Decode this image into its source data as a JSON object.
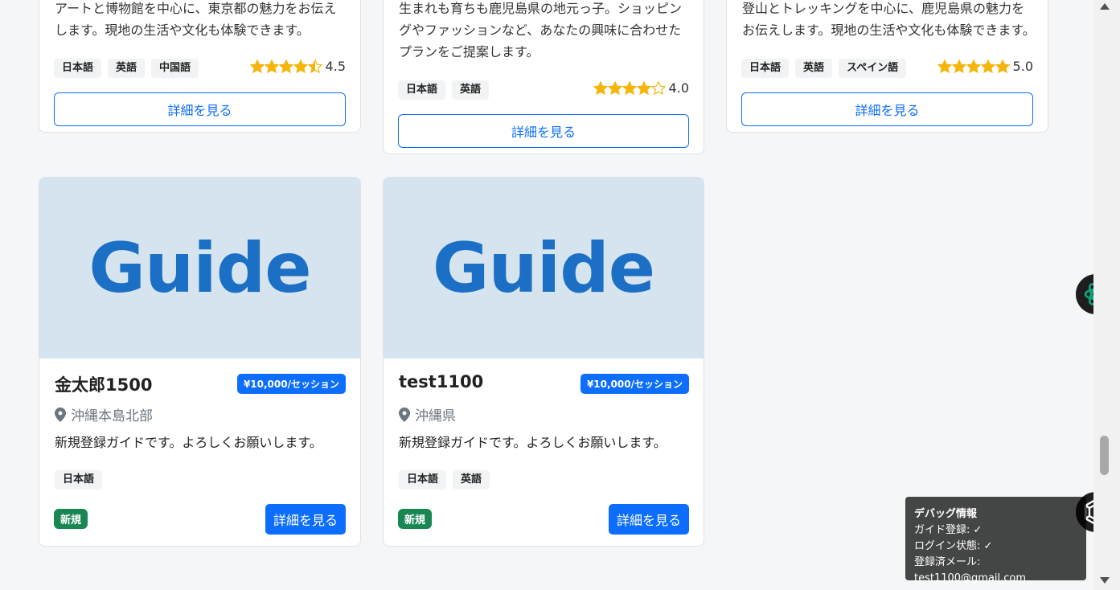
{
  "top_cards": [
    {
      "description": "アートと博物館を中心に、東京都の魅力をお伝えします。現地の生活や文化も体験できます。",
      "languages": [
        "日本語",
        "英語",
        "中国語"
      ],
      "rating": "4.5",
      "rating_value": 4.5,
      "button": "詳細を見る"
    },
    {
      "description": "生まれも育ちも鹿児島県の地元っ子。ショッピングやファッションなど、あなたの興味に合わせたプランをご提案します。",
      "languages": [
        "日本語",
        "英語"
      ],
      "rating": "4.0",
      "rating_value": 4.0,
      "button": "詳細を見る"
    },
    {
      "description": "登山とトレッキングを中心に、鹿児島県の魅力をお伝えします。現地の生活や文化も体験できます。",
      "languages": [
        "日本語",
        "英語",
        "スペイン語"
      ],
      "rating": "5.0",
      "rating_value": 5.0,
      "button": "詳細を見る"
    }
  ],
  "guide_cards": [
    {
      "image_text": "Guide",
      "name": "金太郎1500",
      "price": "¥10,000/セッション",
      "location": "沖縄本島北部",
      "description": "新規登録ガイドです。よろしくお願いします。",
      "languages": [
        "日本語"
      ],
      "badge": "新規",
      "button": "詳細を見る"
    },
    {
      "image_text": "Guide",
      "name": "test1100",
      "price": "¥10,000/セッション",
      "location": "沖縄県",
      "description": "新規登録ガイドです。よろしくお願いします。",
      "languages": [
        "日本語",
        "英語"
      ],
      "badge": "新規",
      "button": "詳細を見る"
    }
  ],
  "debug": {
    "title": "デバッグ情報",
    "line1": "ガイド登録: ✓",
    "line2": "ログイン状態: ✓",
    "line3": "登録済メール: test1100@gmail.com"
  },
  "colors": {
    "primary": "#0d6efd",
    "success": "#198754",
    "star": "#f5b50a",
    "guide_bg": "#d6e4ef",
    "guide_text": "#1b6fc4"
  },
  "icons": [
    "star-icon",
    "map-pin-icon",
    "assistant-icon",
    "chatgpt-icon",
    "scroll-up-icon",
    "scroll-down-icon"
  ]
}
